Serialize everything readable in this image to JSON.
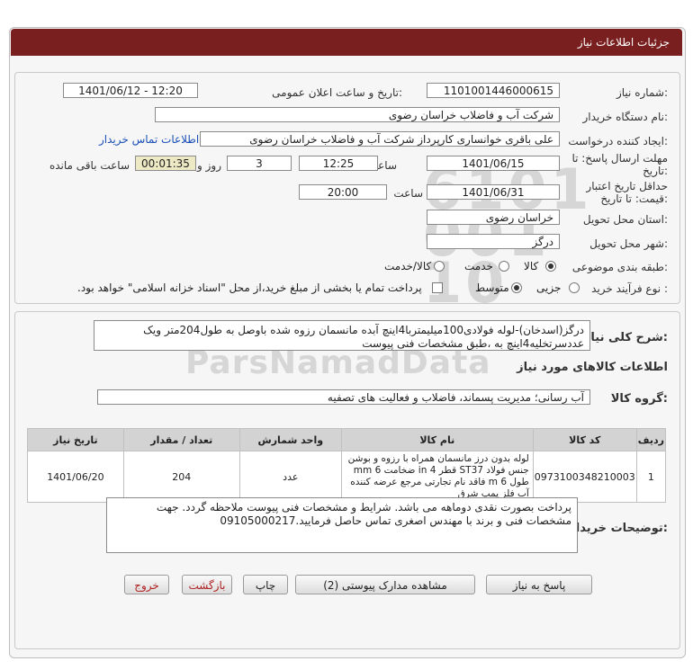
{
  "header": {
    "title": "جزئیات اطلاعات نیاز"
  },
  "watermark": {
    "text": "ParsNamadData"
  },
  "form": {
    "need_number_label": "شماره نیاز:",
    "need_number": "1101001446000615",
    "announce_label": "تاریخ و ساعت اعلان عمومی:",
    "announce_value": "1401/06/12 - 12:20",
    "buyer_org_label": "نام دستگاه خریدار:",
    "buyer_org": "شرکت آب و فاضلاب خراسان رضوی",
    "creator_label": "ایجاد کننده درخواست:",
    "creator": "علی باقری خوانساری کارپرداز شرکت آب و فاضلاب خراسان رضوی",
    "contact_link": "اطلاعات تماس خریدار",
    "reply_deadline_label": "مهلت ارسال پاسخ: تا تاریخ:",
    "reply_date": "1401/06/15",
    "time_label": "ساعت",
    "reply_time": "12:25",
    "days_value": "3",
    "days_label": "روز و",
    "remaining_time": "00:01:35",
    "remaining_label": "ساعت باقی مانده",
    "validity_label": "حداقل تاریخ اعتبار قیمت: تا تاریخ:",
    "validity_date": "1401/06/31",
    "validity_time": "20:00",
    "province_label": "استان محل تحویل:",
    "province": "خراسان رضوی",
    "city_label": "شهر محل تحویل:",
    "city": "درگز",
    "category_label": "طبقه بندی موضوعی:",
    "category_options": [
      "کالا",
      "خدمت",
      "کالا/خدمت"
    ],
    "process_label": "نوع فرآیند خرید :",
    "process_options": [
      "جزیی",
      "متوسط"
    ],
    "treasury_note": "پرداخت تمام یا بخشی از مبلغ خرید،از محل \"اسناد خزانه اسلامی\" خواهد بود."
  },
  "details": {
    "summary_label": "شرح کلی نیاز:",
    "summary": "درگز(اسدخان)-لوله فولادی100میلیمتربا4اینچ آبده مانسمان رزوه شده باوصل به طول204متر ویک عددسرتخلیه4اینچ به ،طبق مشخصات فنی پیوست",
    "goods_info_title": "اطلاعات کالاهای مورد نیاز",
    "goods_group_label": "گروه کالا:",
    "goods_group": "آب رسانی؛ مدیریت پسماند، فاضلاب و فعالیت های تصفیه",
    "table": {
      "headers": [
        "ردیف",
        "کد کالا",
        "نام کالا",
        "واحد شمارش",
        "تعداد / مقدار",
        "تاریخ نیاز"
      ],
      "rows": [
        {
          "row": "1",
          "code": "0973100348210003",
          "name": "لوله بدون درز مانسمان همراه با رزوه و بوشن جنس فولاد ST37 قطر 4 in ضخامت 6 mm طول 6 m فاقد نام تجارتی مرجع عرضه کننده آب فلز پمپ شرق",
          "unit": "عدد",
          "qty": "204",
          "date": "1401/06/20"
        }
      ]
    },
    "buyer_notes_label": "توضیحات خریدار:",
    "buyer_notes": "پرداخت بصورت نقدی دوماهه می باشد. شرایط و مشخصات فنی پیوست ملاحظه گردد. جهت مشخصات فنی و برند با مهندس اصغری تماس حاصل فرمایید.09105000217"
  },
  "buttons": {
    "reply": "پاسخ به نیاز",
    "attachments": "مشاهده مدارک پیوستی (2)",
    "print": "چاپ",
    "back": "بازگشت",
    "exit": "خروج"
  }
}
